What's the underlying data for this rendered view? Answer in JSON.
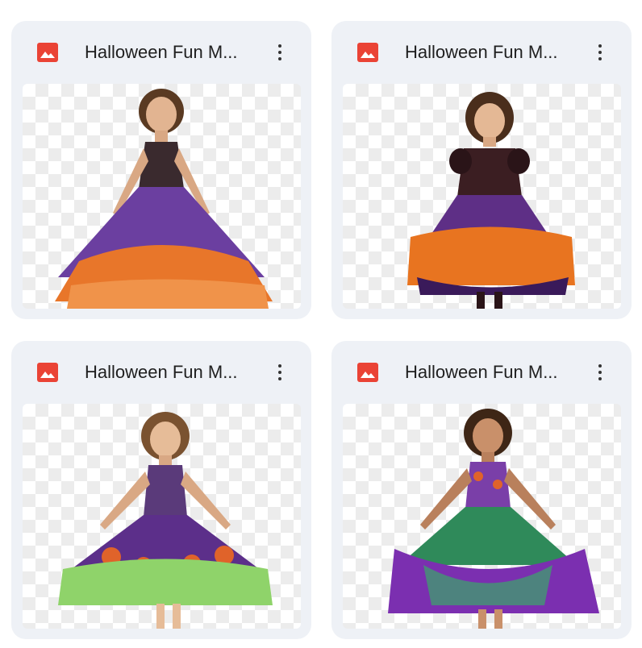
{
  "files": [
    {
      "title": "Halloween Fun M...",
      "icon": "image-file-icon",
      "menu_icon": "more-vert-icon",
      "icon_color": "#ea4335",
      "image_description_colors": {
        "bodice": "#3a2a2e",
        "skirt_top": "#6b3fa0",
        "skirt_bottom": "#e8762a"
      }
    },
    {
      "title": "Halloween Fun M...",
      "icon": "image-file-icon",
      "menu_icon": "more-vert-icon",
      "icon_color": "#ea4335",
      "image_description_colors": {
        "bodice": "#3b1e22",
        "skirt_top": "#5e2f86",
        "skirt_bottom": "#e87420"
      }
    },
    {
      "title": "Halloween Fun M...",
      "icon": "image-file-icon",
      "menu_icon": "more-vert-icon",
      "icon_color": "#ea4335",
      "image_description_colors": {
        "bodice": "#5a3a7a",
        "skirt_top": "#5c2f8a",
        "skirt_bottom": "#8fd36a"
      }
    },
    {
      "title": "Halloween Fun M...",
      "icon": "image-file-icon",
      "menu_icon": "more-vert-icon",
      "icon_color": "#ea4335",
      "image_description_colors": {
        "bodice": "#7a3fa8",
        "skirt_top": "#2f8a5a",
        "skirt_bottom": "#7b2fb0"
      }
    }
  ]
}
